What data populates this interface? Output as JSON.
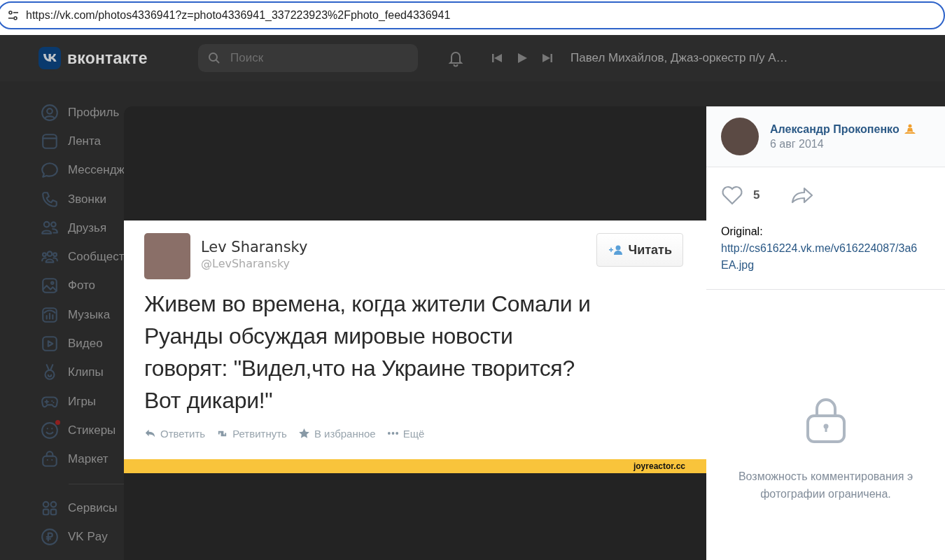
{
  "browser": {
    "url": "https://vk.com/photos4336941?z=photo4336941_337223923%2Fphoto_feed4336941"
  },
  "header": {
    "logo": "вконтакте",
    "search": {
      "placeholder": "Поиск"
    },
    "now_playing": "Павел Михайлов, Джаз-оркестр п/у А…"
  },
  "sidebar": {
    "items": [
      {
        "label": "Профиль",
        "has_dot": false
      },
      {
        "label": "Лента",
        "has_dot": false
      },
      {
        "label": "Мессендж",
        "has_dot": false
      },
      {
        "label": "Звонки",
        "has_dot": false
      },
      {
        "label": "Друзья",
        "has_dot": false
      },
      {
        "label": "Сообщест",
        "has_dot": false
      },
      {
        "label": "Фото",
        "has_dot": false
      },
      {
        "label": "Музыка",
        "has_dot": false
      },
      {
        "label": "Видео",
        "has_dot": false
      },
      {
        "label": "Клипы",
        "has_dot": false
      },
      {
        "label": "Игры",
        "has_dot": false
      },
      {
        "label": "Стикеры",
        "has_dot": true
      },
      {
        "label": "Маркет",
        "has_dot": false
      }
    ],
    "extra_items": [
      {
        "label": "Сервисы",
        "has_dot": false
      },
      {
        "label": "VK Pay",
        "has_dot": false
      }
    ]
  },
  "photo": {
    "tweet": {
      "name": "Lev Sharansky",
      "handle": "@LevSharansky",
      "follow": "Читать",
      "text_lines": [
        "Живем во времена, когда жители Сомали и",
        "Руанды обсуждая мировые новости",
        "говорят: \"Видел,что на Украине творится?",
        "Вот дикари!\""
      ],
      "actions": [
        "Ответить",
        "Ретвитнуть",
        "В избранное",
        "Ещё"
      ],
      "source": "joyreactor.cc"
    }
  },
  "info": {
    "author": "Александр Прокопенко",
    "date": "6 авг 2014",
    "likes": "5",
    "description_label": "Original:",
    "link_lines": [
      "http://cs616224.vk.me/v616224087/3a6",
      "EA.jpg"
    ],
    "comments_notice_lines": [
      "Возможность комментирования э",
      "фотографии ограничена."
    ]
  }
}
